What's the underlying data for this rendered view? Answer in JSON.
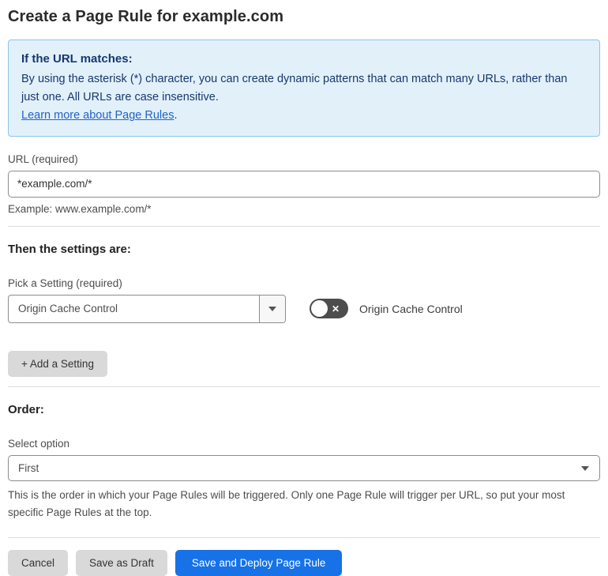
{
  "page": {
    "title": "Create a Page Rule for example.com"
  },
  "colors": {
    "primary_button_blue": "#1672e6",
    "info_box_background": "#e2f0fa",
    "info_box_border": "#8cc5ea",
    "info_box_text": "#17386e",
    "link_blue": "#2063c9",
    "toggle_off_gray": "#4d4d4d",
    "secondary_button_gray": "#d9d9d9"
  },
  "icons": {
    "toggle_off_glyph": "✕",
    "caret_down": "▼"
  },
  "info_box": {
    "heading": "If the URL matches:",
    "body": "By using the asterisk (*) character, you can create dynamic patterns that can match many URLs, rather than just one. All URLs are case insensitive.",
    "link_label": "Learn more about Page Rules",
    "link_suffix": "."
  },
  "url_section": {
    "label": "URL (required)",
    "value": "*example.com/*",
    "example": "Example: www.example.com/*"
  },
  "settings_section": {
    "heading": "Then the settings are:",
    "pick_label": "Pick a Setting (required)",
    "selected_setting": "Origin Cache Control",
    "toggle_state": "off",
    "toggle_label": "Origin Cache Control",
    "add_setting_label": "+ Add a Setting"
  },
  "order_section": {
    "heading": "Order:",
    "select_label": "Select option",
    "selected_option": "First",
    "help": "This is the order in which your Page Rules will be triggered. Only one Page Rule will trigger per URL, so put your most specific Page Rules at the top."
  },
  "footer": {
    "cancel_label": "Cancel",
    "save_draft_label": "Save as Draft",
    "save_deploy_label": "Save and Deploy Page Rule"
  }
}
